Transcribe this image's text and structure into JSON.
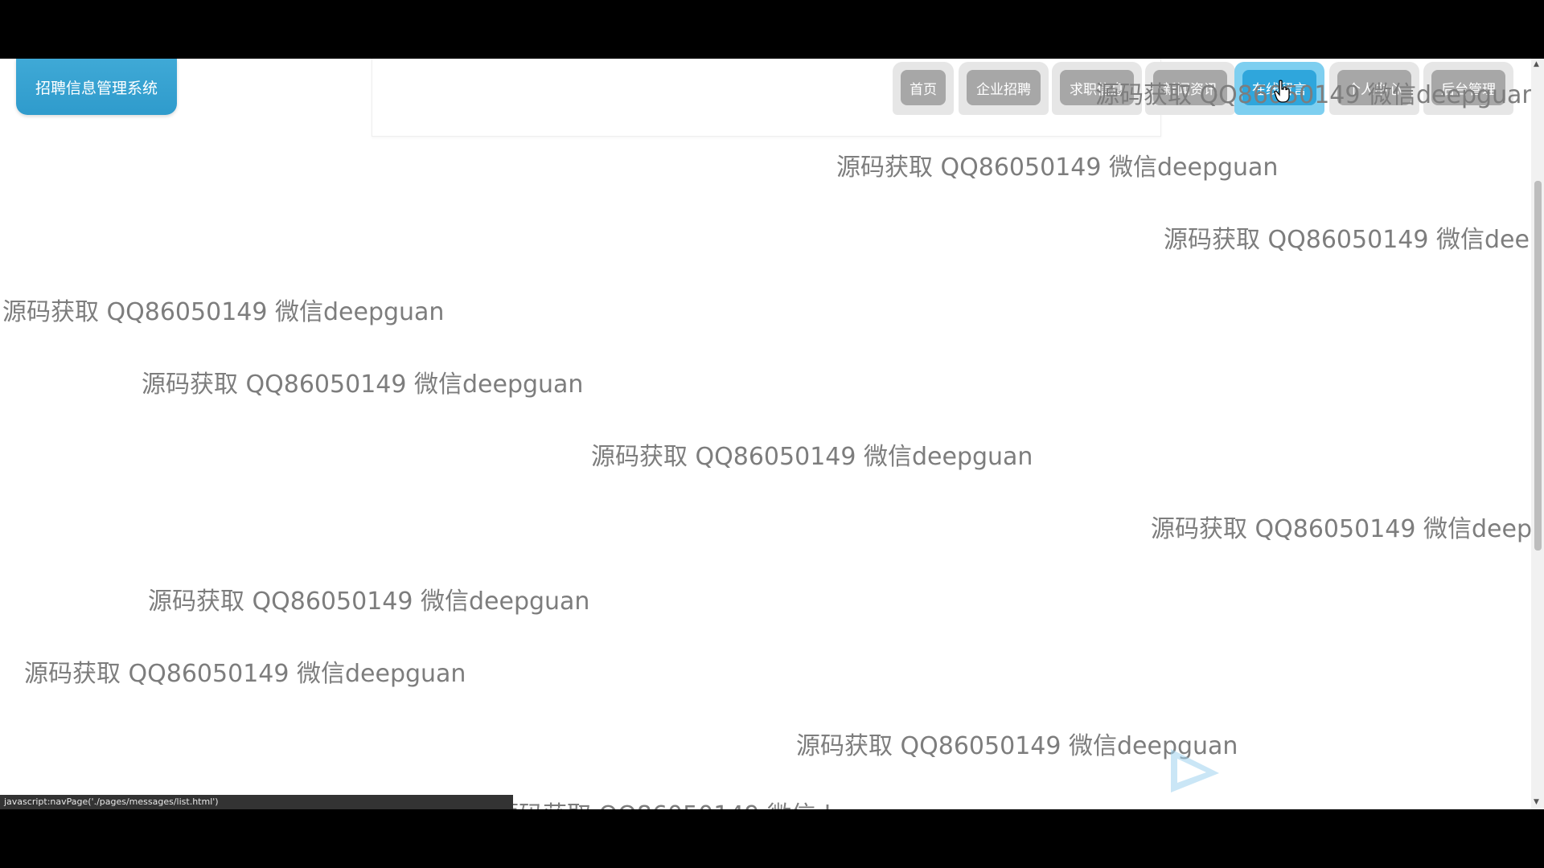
{
  "app": {
    "title": "招聘信息管理系统"
  },
  "nav": {
    "items": [
      {
        "label": "首页",
        "active": false
      },
      {
        "label": "企业招聘",
        "active": false
      },
      {
        "label": "求职信息",
        "active": false
      },
      {
        "label": "新闻资讯",
        "active": false
      },
      {
        "label": "在线留言",
        "active": true
      },
      {
        "label": "个人中心",
        "active": false
      },
      {
        "label": "后台管理",
        "active": false
      }
    ],
    "inactive_color": "#a7a7a7",
    "active_color": "#2fa6dc"
  },
  "watermark": {
    "text": "源码获取 QQ86050149 微信deepguan"
  },
  "status_bar": {
    "url": "javascript:navPage('./pages/messages/list.html')"
  }
}
